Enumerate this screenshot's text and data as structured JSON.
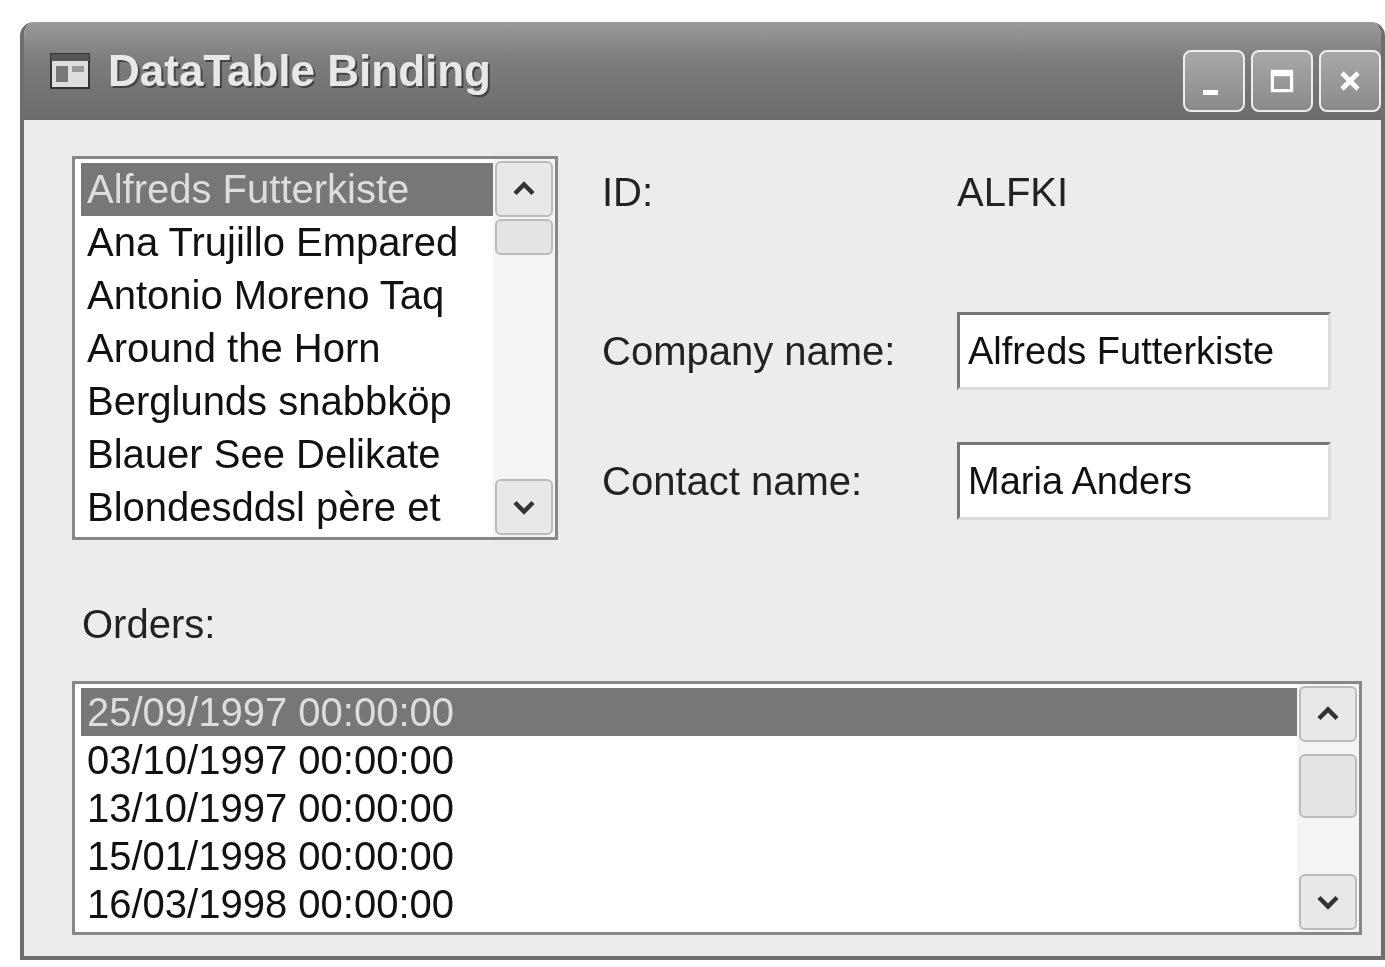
{
  "window": {
    "title": "DataTable Binding"
  },
  "customers": [
    {
      "name": "Alfreds Futterkiste",
      "selected": true
    },
    {
      "name": "Ana Trujillo Empared",
      "selected": false
    },
    {
      "name": "Antonio Moreno Taq",
      "selected": false
    },
    {
      "name": "Around the Horn",
      "selected": false
    },
    {
      "name": "Berglunds snabbköp",
      "selected": false
    },
    {
      "name": "Blauer See Delikate",
      "selected": false
    },
    {
      "name": "Blondesddsl père et",
      "selected": false
    }
  ],
  "details": [
    {
      "kind": "text",
      "label": "ID:",
      "value": "ALFKI"
    },
    {
      "kind": "field",
      "label": "Company name:",
      "value": "Alfreds Futterkiste"
    },
    {
      "kind": "field",
      "label": "Contact name:",
      "value": "Maria Anders"
    }
  ],
  "orders": {
    "label": "Orders:",
    "items": [
      {
        "date": "25/09/1997 00:00:00",
        "selected": true
      },
      {
        "date": "03/10/1997 00:00:00",
        "selected": false
      },
      {
        "date": "13/10/1997 00:00:00",
        "selected": false
      },
      {
        "date": "15/01/1998 00:00:00",
        "selected": false
      },
      {
        "date": "16/03/1998 00:00:00",
        "selected": false
      }
    ]
  }
}
